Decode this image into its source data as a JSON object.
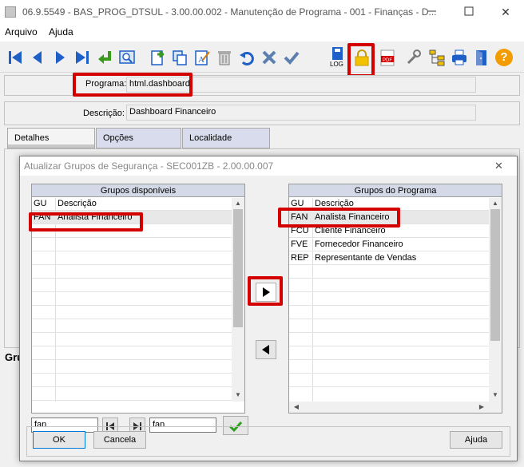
{
  "window": {
    "title": "06.9.5549 - BAS_PROG_DTSUL - 3.00.00.002 - Manutenção de Programa - 001 - Finanças - D...",
    "minimize_icon": "minimize-icon",
    "maximize_icon": "maximize-icon",
    "close_glyph": "✕"
  },
  "menu": {
    "items": [
      "Arquivo",
      "Ajuda"
    ]
  },
  "toolbar": {
    "icons": [
      "first-record-icon",
      "previous-record-icon",
      "next-record-icon",
      "last-record-icon",
      "go-to-icon",
      "search-icon",
      "new-record-icon",
      "copy-record-icon",
      "edit-record-icon",
      "delete-record-icon",
      "undo-icon",
      "cancel-icon",
      "confirm-icon",
      "log-icon",
      "lock-icon",
      "pdf-icon",
      "tools-icon",
      "tree-icon",
      "print-icon",
      "exit-icon",
      "help-icon"
    ],
    "log_label": "LOG",
    "pdf_label": "PDF",
    "help_glyph": "?"
  },
  "form": {
    "programa_label": "Programa:",
    "programa_value": "html.dashboard",
    "descricao_label": "Descrição:",
    "descricao_value": "Dashboard Financeiro",
    "tabs": [
      "Detalhes",
      "Opções",
      "Localidade"
    ],
    "under_dialog_text": "Gru"
  },
  "dialog": {
    "title": "Atualizar Grupos de Segurança - SEC001ZB - 2.00.00.007",
    "close_glyph": "✕",
    "left_grid": {
      "header": "Grupos disponíveis",
      "columns": [
        "GU",
        "Descrição"
      ],
      "rows": [
        {
          "code": "FAN",
          "desc": "Analista Financeiro"
        }
      ]
    },
    "right_grid": {
      "header": "Grupos do Programa",
      "columns": [
        "GU",
        "Descrição"
      ],
      "rows": [
        {
          "code": "FAN",
          "desc": "Analista Financeiro"
        },
        {
          "code": "FCU",
          "desc": "Cliente Financeiro"
        },
        {
          "code": "FVE",
          "desc": "Fornecedor Financeiro"
        },
        {
          "code": "REP",
          "desc": "Representante de Vendas"
        }
      ]
    },
    "search_from": "fan",
    "search_to": "fan",
    "buttons": {
      "ok": "OK",
      "cancel": "Cancela",
      "help": "Ajuda"
    }
  },
  "colors": {
    "highlight": "#d40000",
    "grid_header": "#d3d9e7",
    "toolbar_blue": "#1e5fc8"
  }
}
